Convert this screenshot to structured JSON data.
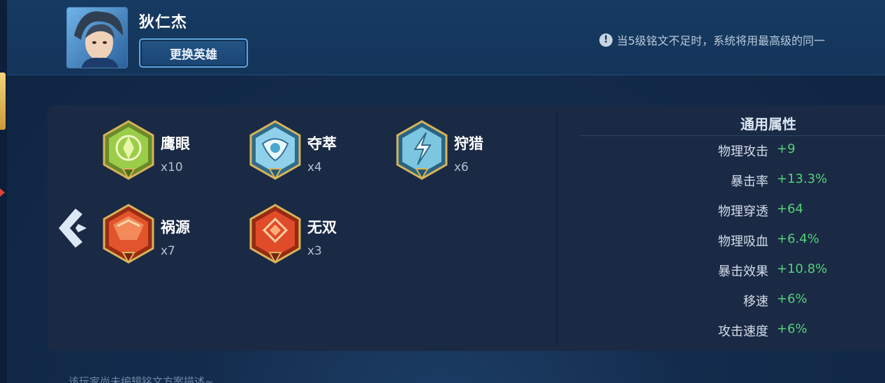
{
  "header": {
    "hero_name": "狄仁杰",
    "switch_button": "更换英雄",
    "notice_icon": "!",
    "notice": "当5级铭文不足时，系统将用最高级的同一"
  },
  "runes": [
    {
      "name": "鹰眼",
      "count": "x10",
      "icon": "green-rune-icon",
      "color": "#7fb842"
    },
    {
      "name": "夺萃",
      "count": "x4",
      "icon": "blue-rune-icon",
      "color": "#8fd0ea"
    },
    {
      "name": "狩猎",
      "count": "x6",
      "icon": "blue-rune-icon",
      "color": "#7cc6e0"
    },
    {
      "name": "祸源",
      "count": "x7",
      "icon": "red-rune-icon",
      "color": "#e2542c"
    },
    {
      "name": "无双",
      "count": "x3",
      "icon": "red-rune-icon",
      "color": "#e04b2a"
    }
  ],
  "attributes": {
    "title": "通用属性",
    "rows": [
      {
        "label": "物理攻击",
        "value": "+9"
      },
      {
        "label": "暴击率",
        "value": "+13.3%"
      },
      {
        "label": "物理穿透",
        "value": "+64"
      },
      {
        "label": "物理吸血",
        "value": "+6.4%"
      },
      {
        "label": "暴击效果",
        "value": "+10.8%"
      },
      {
        "label": "移速",
        "value": "+6%"
      },
      {
        "label": "攻击速度",
        "value": "+6%"
      }
    ]
  },
  "footer": {
    "text": "该玩家尚未编辑铭文方案描述~"
  },
  "colors": {
    "value_green": "#55d07a",
    "gold_frame": "#d8b45a"
  }
}
